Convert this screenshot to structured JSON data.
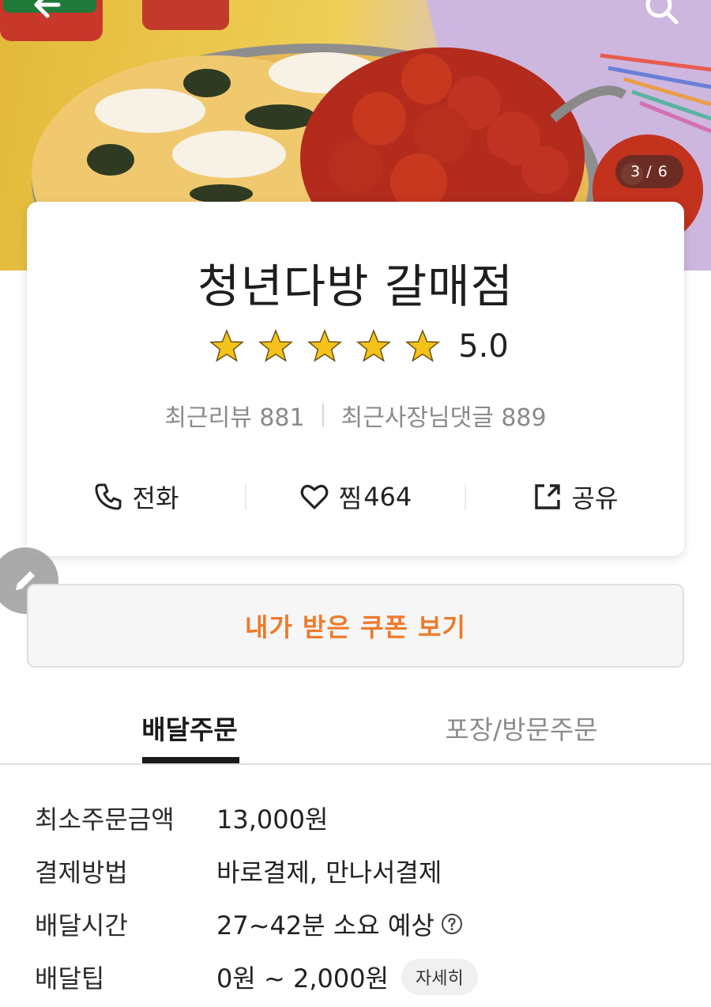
{
  "hero": {
    "counter": "3 / 6",
    "icons": [
      "back-arrow-icon",
      "search-icon"
    ]
  },
  "store": {
    "name": "청년다방 갈매점",
    "rating": "5.0",
    "star_count": 5,
    "reviews_label": "최근리뷰 881",
    "owner_comments_label": "최근사장님댓글 889"
  },
  "actions": {
    "call_label": "전화",
    "like_label": "찜",
    "like_count": "464",
    "share_label": "공유"
  },
  "coupon": {
    "label": "내가 받은 쿠폰 보기",
    "color": "#ee7a2c"
  },
  "tabs": [
    {
      "label": "배달주문",
      "active": true
    },
    {
      "label": "포장/방문주문",
      "active": false
    }
  ],
  "info": [
    {
      "label": "최소주문금액",
      "value": "13,000원"
    },
    {
      "label": "결제방법",
      "value": "바로결제, 만나서결제"
    },
    {
      "label": "배달시간",
      "value": "27~42분 소요 예상"
    },
    {
      "label": "배달팁",
      "value": "0원 ~ 2,000원",
      "button": "자세히"
    }
  ],
  "colors": {
    "star": "#f5c21b",
    "accent": "#ee7a2c"
  }
}
